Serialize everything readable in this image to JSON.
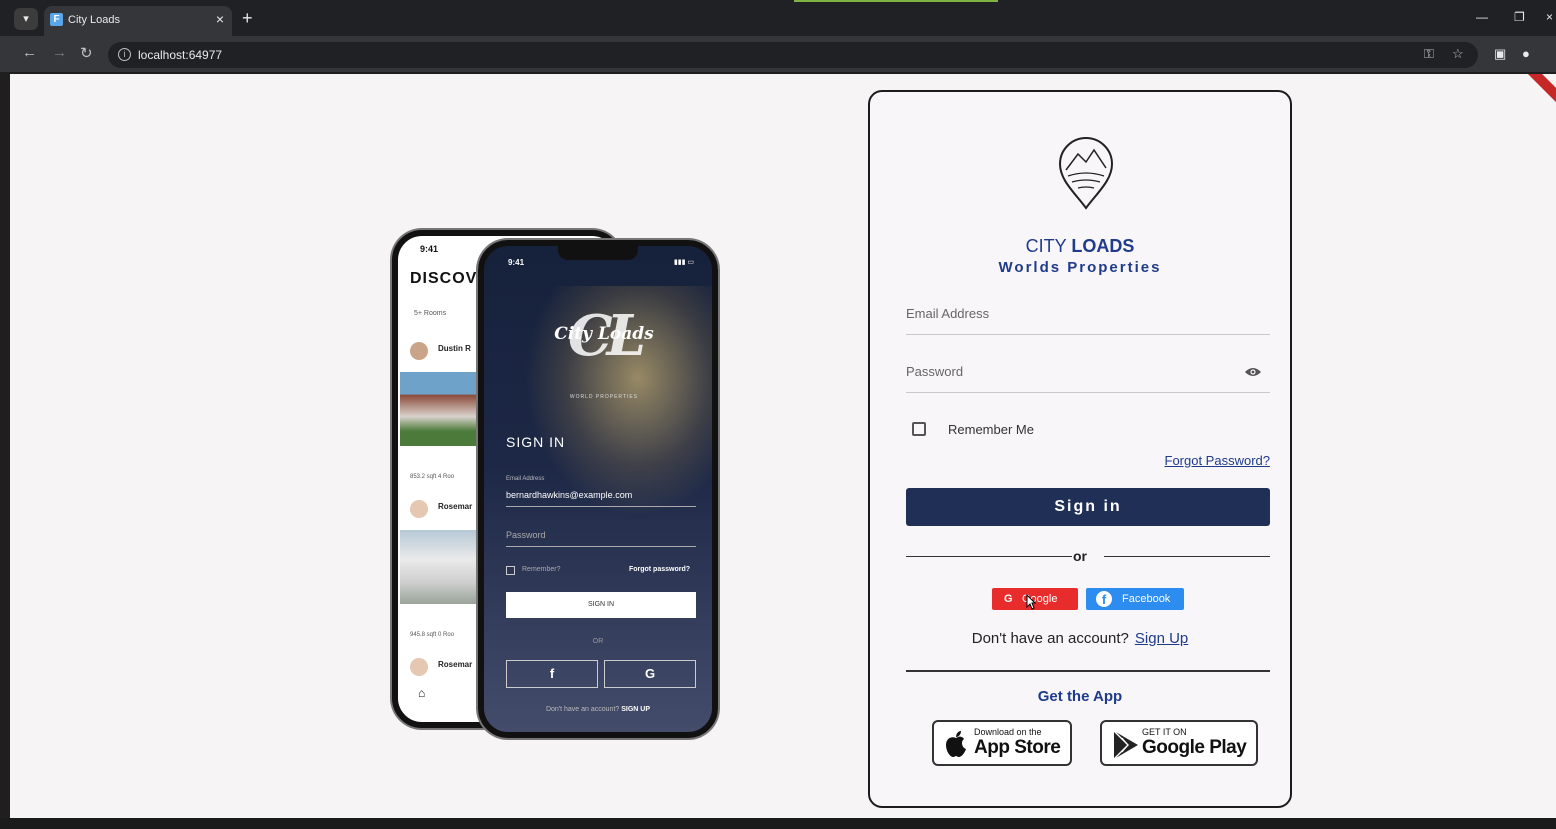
{
  "browser": {
    "tab_title": "City Loads",
    "url": "localhost:64977"
  },
  "phone_back": {
    "time": "9:41",
    "heading": "DISCOVI",
    "chip": "5+ Rooms",
    "row1_name": "Dustin R",
    "row1_meta": "853.2 sqft   4 Roo",
    "row2_name": "Rosemar",
    "row2_meta": "945.8 sqft   0 Roo",
    "row3_name": "Rosemar"
  },
  "phone_front": {
    "time": "9:41",
    "logo_mark": "CL",
    "logo_text": "City Loads",
    "logo_sub": "WORLD PROPERTIES",
    "title": "SIGN IN",
    "email_label": "Email Address",
    "email_value": "bernardhawkins@example.com",
    "password_label": "Password",
    "remember_label": "Remember?",
    "forgot_label": "Forgot password?",
    "signin_label": "SIGN IN",
    "or_label": "OR",
    "facebook_glyph": "f",
    "google_glyph": "G",
    "bottom_text": "Don't have an account?",
    "bottom_link": "SIGN UP"
  },
  "login": {
    "brand_line1_a": "CITY",
    "brand_line1_b": "LOADS",
    "brand_line2": "Worlds Properties",
    "email_label": "Email Address",
    "password_label": "Password",
    "remember_label": "Remember Me",
    "forgot_label": "Forgot Password?",
    "signin_label": "Sign in",
    "or_label": "or",
    "google_label": "Google",
    "facebook_label": "Facebook",
    "no_account_text": "Don't have an account?",
    "signup_label": "Sign Up",
    "get_app_label": "Get the App",
    "appstore_small": "Download on the",
    "appstore_big": "App Store",
    "playstore_small": "GET IT ON",
    "playstore_big": "Google Play"
  },
  "colors": {
    "brand_blue": "#1f3b8c",
    "signin_button": "#1f2f55",
    "google_red": "#e82c2c",
    "facebook_blue": "#2d8cf0",
    "page_bg": "#f7f4f6"
  }
}
